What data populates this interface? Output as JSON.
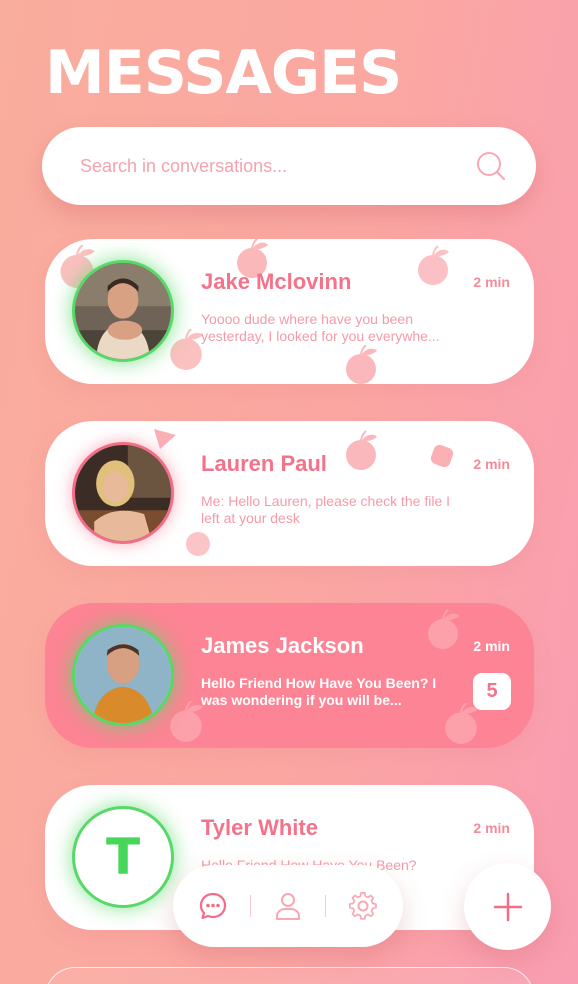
{
  "header": {
    "title": "MESSAGES"
  },
  "search": {
    "placeholder": "Search in conversations..."
  },
  "conversations": [
    {
      "name": "Jake Mclovinn",
      "time": "2 min",
      "preview": "Yoooo dude where have you been yesterday, I looked for you everywhe...",
      "online": true,
      "active": false
    },
    {
      "name": "Lauren Paul",
      "time": "2 min",
      "preview": "Me: Hello Lauren, please check the file I left at your desk",
      "online": false,
      "active": false
    },
    {
      "name": "James Jackson",
      "time": "2 min",
      "preview": "Hello Friend How Have You Been? I was wondering if you will be...",
      "unread": "5",
      "online": true,
      "active": true
    },
    {
      "name": "Tyler White",
      "time": "2 min",
      "avatar_initial": "T",
      "preview": "Hello Friend How Have You Been?",
      "online": true,
      "active": false
    }
  ],
  "nav": {
    "items": [
      {
        "icon": "chat-icon"
      },
      {
        "icon": "profile-icon"
      },
      {
        "icon": "settings-gear-icon"
      }
    ],
    "fab_icon": "plus-icon"
  },
  "colors": {
    "accent": "#f4738a",
    "active_card": "#fd8494",
    "online_ring": "#58d868",
    "background_start": "#f9ad9c",
    "background_end": "#f99db2"
  }
}
